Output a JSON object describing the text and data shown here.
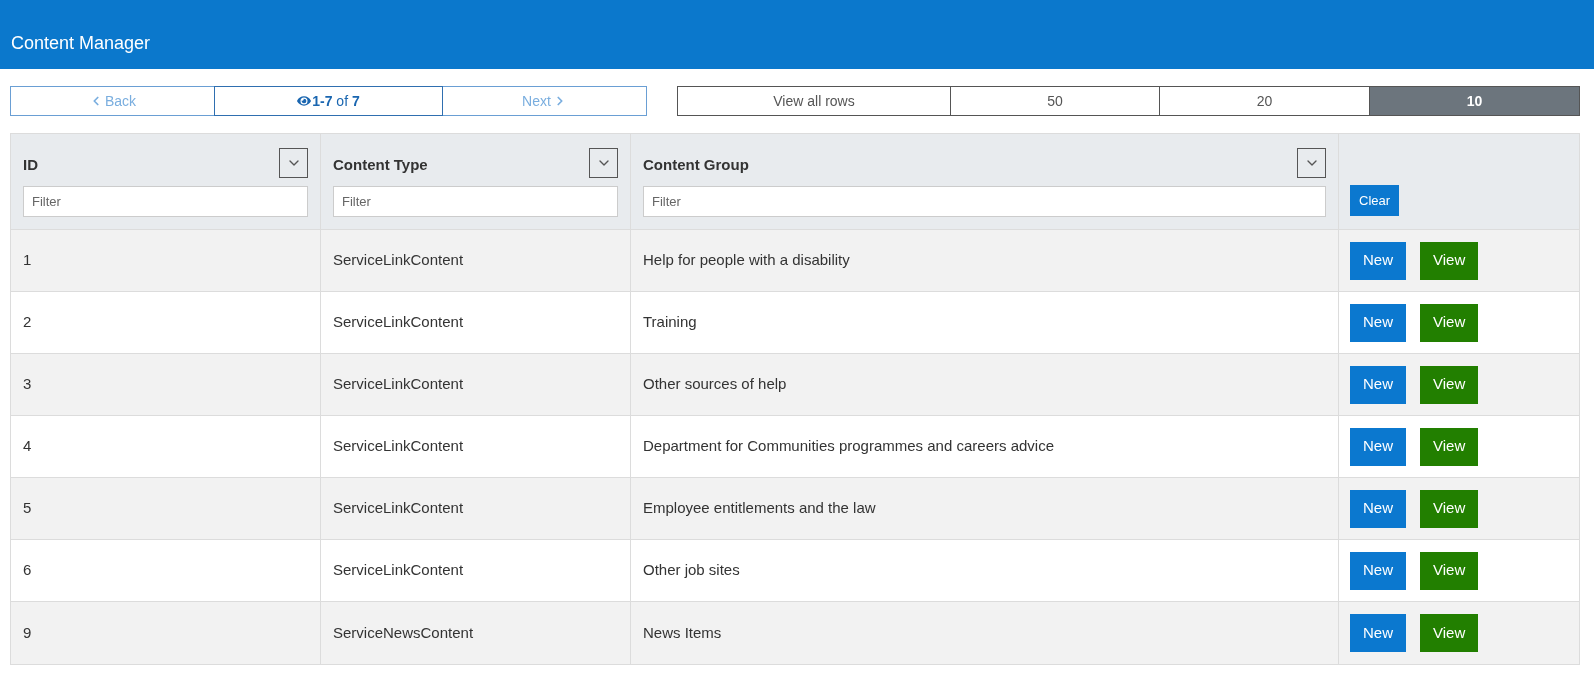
{
  "header": {
    "title": "Content Manager"
  },
  "pager": {
    "back": {
      "label": "Back",
      "disabled": true
    },
    "status": "**1-7** of **7**",
    "next": {
      "label": "Next",
      "disabled": true
    }
  },
  "page_sizes": [
    {
      "label": "View all rows",
      "selected": false
    },
    {
      "label": "50",
      "selected": false
    },
    {
      "label": "20",
      "selected": false
    },
    {
      "label": "10",
      "selected": true
    }
  ],
  "table": {
    "columns": [
      {
        "label": "ID",
        "filter_placeholder": "Filter"
      },
      {
        "label": "Content Type",
        "filter_placeholder": "Filter"
      },
      {
        "label": "Content Group",
        "filter_placeholder": "Filter"
      }
    ],
    "clear_button": "Clear",
    "rows": [
      {
        "cells": [
          "1",
          "ServiceLinkContent",
          "Help for people with a disability"
        ],
        "actions": [
          {
            "label": "New",
            "kind": "primary"
          },
          {
            "label": "View",
            "kind": "success"
          }
        ]
      },
      {
        "cells": [
          "2",
          "ServiceLinkContent",
          "Training"
        ],
        "actions": [
          {
            "label": "New",
            "kind": "primary"
          },
          {
            "label": "View",
            "kind": "success"
          }
        ]
      },
      {
        "cells": [
          "3",
          "ServiceLinkContent",
          "Other sources of help"
        ],
        "actions": [
          {
            "label": "New",
            "kind": "primary"
          },
          {
            "label": "View",
            "kind": "success"
          }
        ]
      },
      {
        "cells": [
          "4",
          "ServiceLinkContent",
          "Department for Communities programmes and careers advice"
        ],
        "actions": [
          {
            "label": "New",
            "kind": "primary"
          },
          {
            "label": "View",
            "kind": "success"
          }
        ]
      },
      {
        "cells": [
          "5",
          "ServiceLinkContent",
          "Employee entitlements and the law"
        ],
        "actions": [
          {
            "label": "New",
            "kind": "primary"
          },
          {
            "label": "View",
            "kind": "success"
          }
        ]
      },
      {
        "cells": [
          "6",
          "ServiceLinkContent",
          "Other job sites"
        ],
        "actions": [
          {
            "label": "New",
            "kind": "primary"
          },
          {
            "label": "View",
            "kind": "success"
          }
        ]
      },
      {
        "cells": [
          "9",
          "ServiceNewsContent",
          "News Items"
        ],
        "actions": [
          {
            "label": "New",
            "kind": "primary"
          },
          {
            "label": "View",
            "kind": "success"
          }
        ]
      }
    ]
  }
}
